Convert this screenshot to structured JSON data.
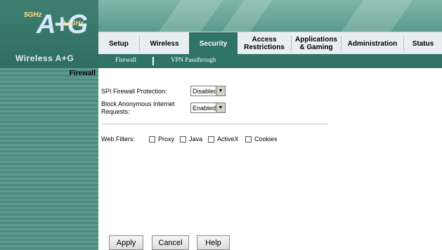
{
  "brand": {
    "badge_small_left": "5GHz",
    "badge_letter": "A+G",
    "badge_small_right": "2.4GHz",
    "product_name": "Wireless A+G"
  },
  "tabs": [
    {
      "label": "Setup"
    },
    {
      "label": "Wireless"
    },
    {
      "label": "Security",
      "active": true
    },
    {
      "label": "Access Restrictions"
    },
    {
      "label": "Applications & Gaming"
    },
    {
      "label": "Administration"
    },
    {
      "label": "Status"
    }
  ],
  "subtabs": [
    {
      "label": "Firewall"
    },
    {
      "label": "VPN Passthrough"
    }
  ],
  "section": {
    "title": "Firewall"
  },
  "form": {
    "spi_label": "SPI Firewall Protection:",
    "spi_value": "Disabled",
    "block_label_line1": "Block Anonymous Internet",
    "block_label_line2": "Requests:",
    "block_value": "Enabled",
    "web_filters_label": "Web Filters:",
    "filters": [
      {
        "label": "Proxy",
        "checked": false
      },
      {
        "label": "Java",
        "checked": false
      },
      {
        "label": "ActiveX",
        "checked": false
      },
      {
        "label": "Cookies",
        "checked": false
      }
    ]
  },
  "buttons": {
    "apply": "Apply",
    "cancel": "Cancel",
    "help": "Help"
  },
  "colors": {
    "header_teal": "#5c9b8c",
    "active_tab": "#2f7465",
    "tabbar_bg": "#e9eef0"
  }
}
